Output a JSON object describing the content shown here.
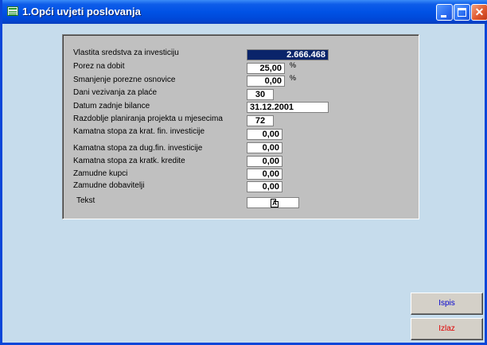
{
  "window": {
    "title": "1.Opći uvjeti poslovanja",
    "minimize_label": "_",
    "maximize_label": "□",
    "close_label": "✕"
  },
  "form": {
    "fields": [
      {
        "label": "Vlastita sredstva za investiciju",
        "value": "2.666.468",
        "selected": true
      },
      {
        "label": "Porez na dobit",
        "value": "25,00",
        "unit": "%"
      },
      {
        "label": "Smanjenje porezne osnovice",
        "value": "0,00",
        "unit": "%"
      },
      {
        "label": "Dani vezivanja za plaće",
        "value": "30"
      },
      {
        "label": "Datum zadnje  bilance",
        "value": "31.12.2001"
      },
      {
        "label": "Razdoblje planiranja projekta u mjesecima",
        "value": "72"
      },
      {
        "label": "Kamatna stopa za krat. fin. investicije",
        "value": "0,00"
      },
      {
        "label": "Kamatna stopa za dug.fin. investicije",
        "value": "0,00"
      },
      {
        "label": "Kamatna stopa za kratk. kredite",
        "value": "0,00"
      },
      {
        "label": "Zamudne kupci",
        "value": "0,00"
      },
      {
        "label": "Zamudne dobavitelji",
        "value": "0,00"
      },
      {
        "label": "Tekst",
        "value": "",
        "icon": "document-a-icon"
      }
    ]
  },
  "buttons": {
    "print": "Ispis",
    "exit": "Izlaz"
  },
  "colors": {
    "titlebar": "#0052e5",
    "client_bg": "#c6dcec",
    "panel_bg": "#c0c0c0",
    "print_text": "#0000d0",
    "exit_text": "#e00000"
  }
}
